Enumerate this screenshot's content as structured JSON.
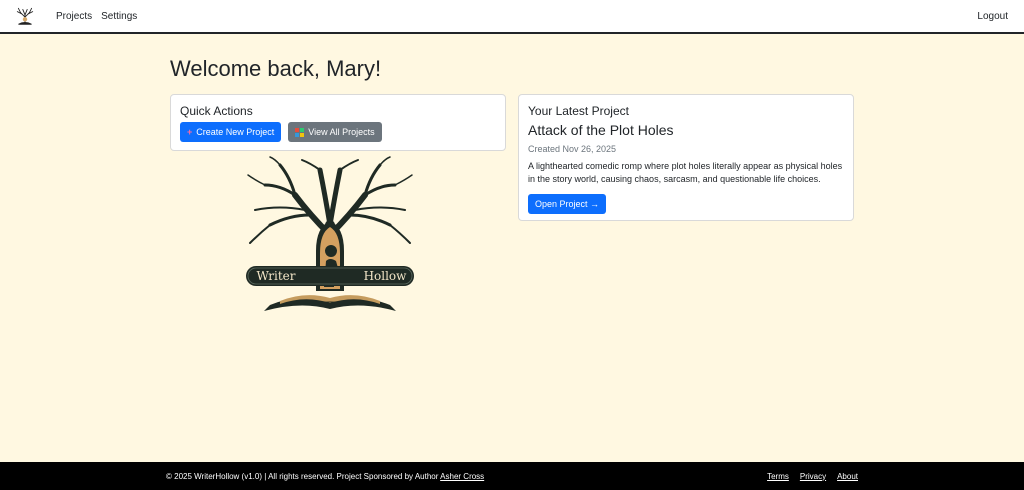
{
  "nav": {
    "logo_icon": "tree-logo-icon",
    "links": [
      "Projects",
      "Settings"
    ],
    "logout": "Logout"
  },
  "main": {
    "welcome": "Welcome back, Mary!",
    "quick_actions": {
      "title": "Quick Actions",
      "create_label": "Create New Project",
      "view_label": "View All Projects"
    },
    "latest": {
      "title": "Your Latest Project",
      "project_name": "Attack of the Plot Holes",
      "created": "Created Nov 26, 2025",
      "description": "A lighthearted comedic romp where plot holes literally appear as physical holes in the story world, causing chaos, sarcasm, and questionable life choices.",
      "open_label": "Open Project →"
    },
    "logo_text_left": "Writer",
    "logo_text_right": "Hollow"
  },
  "footer": {
    "copyright": "© 2025 WriterHollow (v1.0) | All rights reserved. Project Sponsored by Author ",
    "author_link": "Asher Cross",
    "links": [
      "Terms",
      "Privacy",
      "About"
    ]
  },
  "colors": {
    "background": "#fff8e1",
    "primary": "#0d6efd",
    "secondary": "#6c757d",
    "footer": "#000000"
  }
}
